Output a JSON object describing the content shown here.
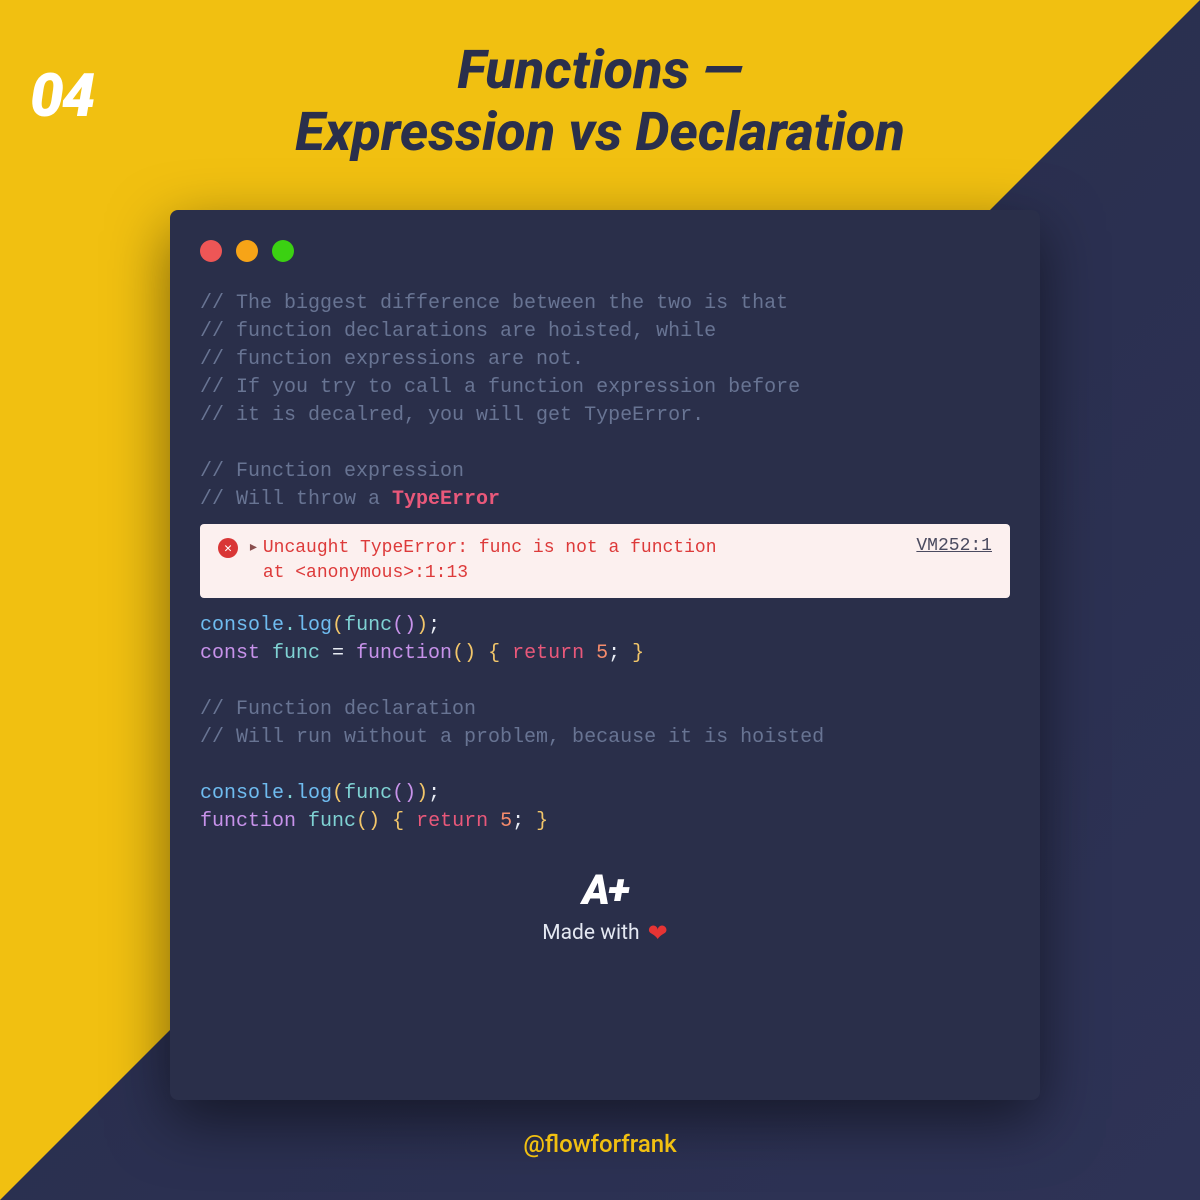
{
  "page_number": "04",
  "title_line1": "Functions —",
  "title_line2": "Expression vs Declaration",
  "comments": {
    "c1": "// The biggest difference between the two is that",
    "c2": "// function declarations are hoisted, while",
    "c3": "// function expressions are not.",
    "c4": "// If you try to call a function expression before",
    "c5": "// it is decalred, you will get TypeError.",
    "c6": "// Function expression",
    "c7a": "// Will throw a ",
    "c7b": "TypeError",
    "c8": "// Function declaration",
    "c9": "// Will run without a problem, because it is hoisted"
  },
  "error": {
    "icon": "✕",
    "arrow": "▸",
    "line1": "Uncaught TypeError: func is not a function",
    "line2": "    at <anonymous>:1:13",
    "source": "VM252:1"
  },
  "tokens": {
    "console": "console",
    "dot": ".",
    "log": "log",
    "lparen": "(",
    "func": "func",
    "rparen": ")",
    "rparen2": ")",
    "semi": ";",
    "const": "const ",
    "funcName": "func",
    "eq": " = ",
    "function": "function",
    "lbrace": " { ",
    "return": "return ",
    "five": "5",
    "rbrace": " }",
    "space": " "
  },
  "footer": {
    "logo": "A+",
    "made": "Made with",
    "heart": "❤"
  },
  "handle": "@flowforfrank"
}
